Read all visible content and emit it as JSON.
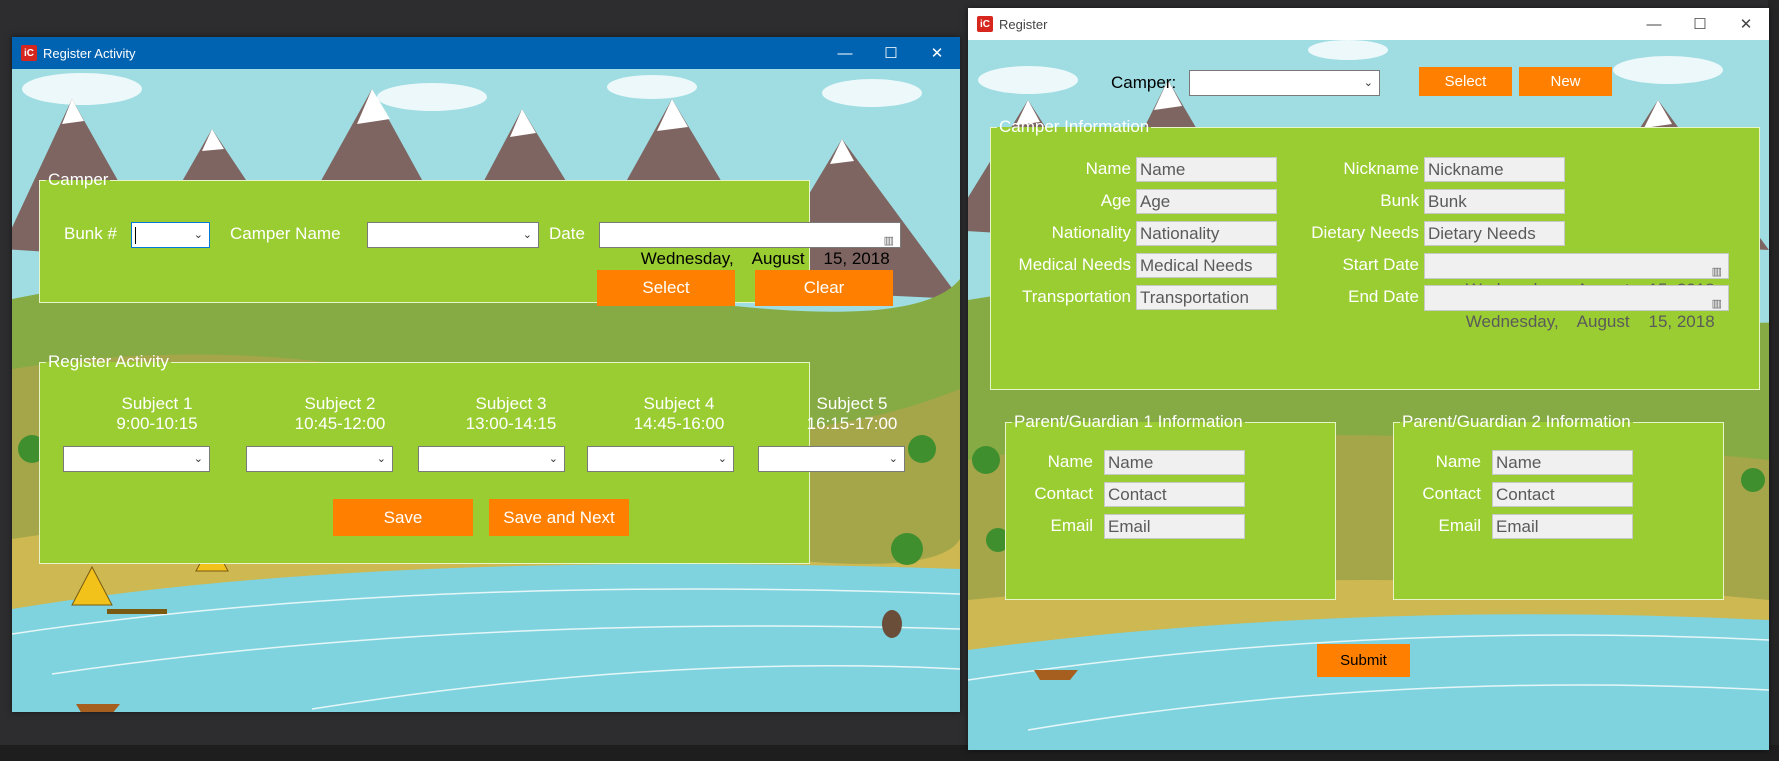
{
  "ide": {},
  "win1": {
    "title": "Register Activity",
    "minimize": "—",
    "maximize": "☐",
    "close": "✕",
    "camper_group": {
      "legend": "Camper",
      "bunk_label": "Bunk #",
      "camper_name_label": "Camper Name",
      "date_label": "Date",
      "date_value": "Wednesday,    August    15, 2018",
      "select_label": "Select",
      "clear_label": "Clear"
    },
    "activity_group": {
      "legend": "Register Activity",
      "subjects": [
        {
          "name": "Subject 1",
          "time": "9:00-10:15"
        },
        {
          "name": "Subject 2",
          "time": "10:45-12:00"
        },
        {
          "name": "Subject 3",
          "time": "13:00-14:15"
        },
        {
          "name": "Subject 4",
          "time": "14:45-16:00"
        },
        {
          "name": "Subject 5",
          "time": "16:15-17:00"
        }
      ],
      "save_label": "Save",
      "save_next_label": "Save and Next"
    }
  },
  "win2": {
    "title": "Register",
    "minimize": "—",
    "maximize": "☐",
    "close": "✕",
    "camper_label": "Camper:",
    "select_label": "Select",
    "new_label": "New",
    "camper_info": {
      "legend": "Camper Information",
      "name_label": "Name",
      "name_value": "Name",
      "age_label": "Age",
      "age_value": "Age",
      "nationality_label": "Nationality",
      "nationality_value": "Nationality",
      "medical_label": "Medical Needs",
      "medical_value": "Medical Needs",
      "transport_label": "Transportation",
      "transport_value": "Transportation",
      "nickname_label": "Nickname",
      "nickname_value": "Nickname",
      "bunk_label": "Bunk",
      "bunk_value": "Bunk",
      "dietary_label": "Dietary Needs",
      "dietary_value": "Dietary Needs",
      "start_label": "Start Date",
      "start_value": "Wednesday,    August    15, 2018",
      "end_label": "End Date",
      "end_value": "Wednesday,    August    15, 2018"
    },
    "parent1": {
      "legend": "Parent/Guardian 1 Information",
      "name_label": "Name",
      "name_value": "Name",
      "contact_label": "Contact",
      "contact_value": "Contact",
      "email_label": "Email",
      "email_value": "Email"
    },
    "parent2": {
      "legend": "Parent/Guardian 2 Information",
      "name_label": "Name",
      "name_value": "Name",
      "contact_label": "Contact",
      "contact_value": "Contact",
      "email_label": "Email",
      "email_value": "Email"
    },
    "submit_label": "Submit"
  },
  "colors": {
    "group_green": "#9acd32",
    "button_orange": "#ff8000",
    "titlebar_blue": "#0063b1",
    "water": "#7fd3de",
    "sky": "#9fdde3"
  },
  "icons": {
    "app_icon": "iC",
    "dropdown": "⌄",
    "calendar": "▥"
  }
}
